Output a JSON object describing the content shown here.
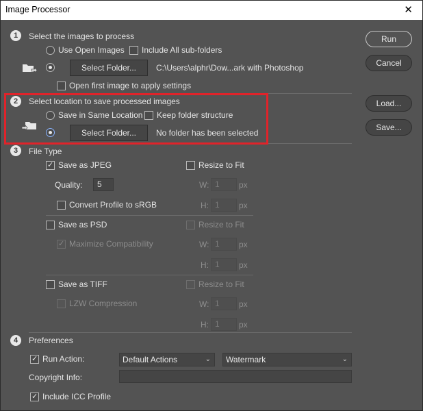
{
  "window": {
    "title": "Image Processor",
    "close_glyph": "✕"
  },
  "section1": {
    "number": "1",
    "heading": "Select the images to process",
    "use_open_images": "Use Open Images",
    "include_subfolders": "Include All sub-folders",
    "select_folder_button": "Select Folder...",
    "folder_path": "C:\\Users\\alphr\\Dow...ark with Photoshop",
    "open_first_image": "Open first image to apply settings"
  },
  "section2": {
    "number": "2",
    "heading": "Select location to save processed images",
    "save_same_location": "Save in Same Location",
    "keep_folder_structure": "Keep folder structure",
    "select_folder_button": "Select Folder...",
    "folder_status": "No folder has been selected"
  },
  "section3": {
    "number": "3",
    "heading": "File Type",
    "jpeg": {
      "save_as": "Save as JPEG",
      "resize": "Resize to Fit",
      "quality_label": "Quality:",
      "quality_value": "5",
      "w_label": "W:",
      "w_value": "1",
      "w_unit": "px",
      "h_label": "H:",
      "h_value": "1",
      "h_unit": "px",
      "convert_profile": "Convert Profile to sRGB"
    },
    "psd": {
      "save_as": "Save as PSD",
      "resize": "Resize to Fit",
      "maximize": "Maximize Compatibility",
      "w_label": "W:",
      "w_value": "1",
      "w_unit": "px",
      "h_label": "H:",
      "h_value": "1",
      "h_unit": "px"
    },
    "tiff": {
      "save_as": "Save as TIFF",
      "resize": "Resize to Fit",
      "lzw": "LZW Compression",
      "w_label": "W:",
      "w_value": "1",
      "w_unit": "px",
      "h_label": "H:",
      "h_value": "1",
      "h_unit": "px"
    }
  },
  "section4": {
    "number": "4",
    "heading": "Preferences",
    "run_action": "Run Action:",
    "action_set": "Default Actions",
    "action": "Watermark",
    "copyright_label": "Copyright Info:",
    "copyright_value": "",
    "include_icc": "Include ICC Profile"
  },
  "side_buttons": {
    "run": "Run",
    "cancel": "Cancel",
    "load": "Load...",
    "save": "Save..."
  },
  "colors": {
    "background": "#535353",
    "highlight": "#e1232a",
    "titlebar": "#ffffff"
  },
  "icons": {
    "source_folder": "folder-arrow-icon",
    "dest_folder": "folder-arrow-icon"
  }
}
